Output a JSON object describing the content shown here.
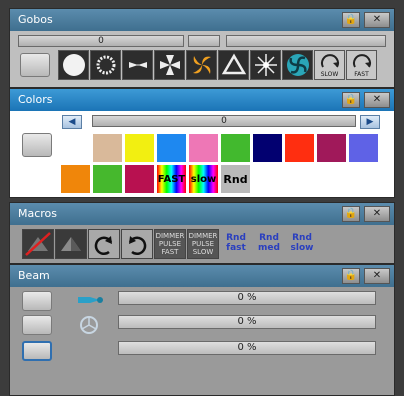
{
  "gobos": {
    "title": "Gobos",
    "slider_value": "0",
    "icons": [
      "open-circle-icon",
      "dots-ring-icon",
      "bowtie-icon",
      "fan-icon",
      "spiral-icon",
      "triangle-icon",
      "starburst-icon",
      "swirl-icon",
      "rotate-slow-icon",
      "rotate-fast-icon"
    ],
    "slow_label": "SLOW",
    "fast_label": "FAST"
  },
  "colors": {
    "title": "Colors",
    "slider_value": "0",
    "swatches_row1": [
      "#d9b99a",
      "#f2ef11",
      "#1e88f0",
      "#ee77b6",
      "#42b92e",
      "#020070",
      "#ff2e10",
      "#a0195a",
      "#5f62e6"
    ],
    "swatches_row2": [
      "#f0860a",
      "#46b82d",
      "#b81150"
    ],
    "fast_label": "FAST",
    "slow_label": "slow",
    "rnd_label": "Rnd"
  },
  "macros": {
    "title": "Macros",
    "dimmer_fast": [
      "DIMMER",
      "PULSE",
      "FAST"
    ],
    "dimmer_slow": [
      "DIMMER",
      "PULSE",
      "SLOW"
    ],
    "rnd_items": [
      {
        "top": "Rnd",
        "bottom": "fast"
      },
      {
        "top": "Rnd",
        "bottom": "med"
      },
      {
        "top": "Rnd",
        "bottom": "slow"
      }
    ]
  },
  "beam": {
    "title": "Beam",
    "bars": [
      "0 %",
      "0 %",
      "0 %"
    ]
  }
}
